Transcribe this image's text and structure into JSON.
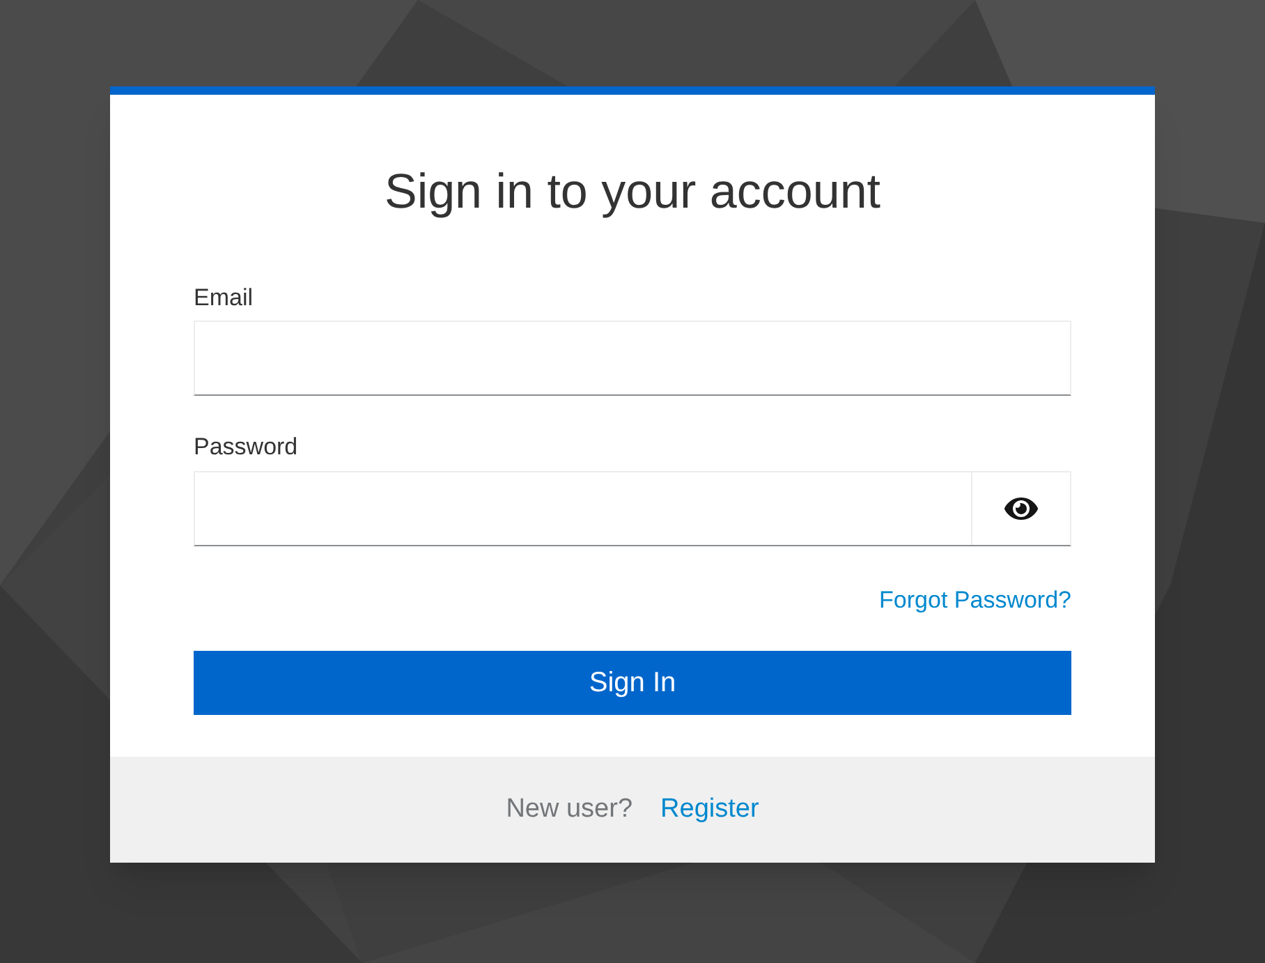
{
  "title": "Sign in to your account",
  "fields": [
    {
      "label": "Email",
      "kind": "text"
    },
    {
      "label": "Password",
      "kind": "password"
    }
  ],
  "forgot_link": "Forgot Password?",
  "submit": "Sign In",
  "footer": {
    "prompt": "New user?",
    "link": "Register"
  }
}
